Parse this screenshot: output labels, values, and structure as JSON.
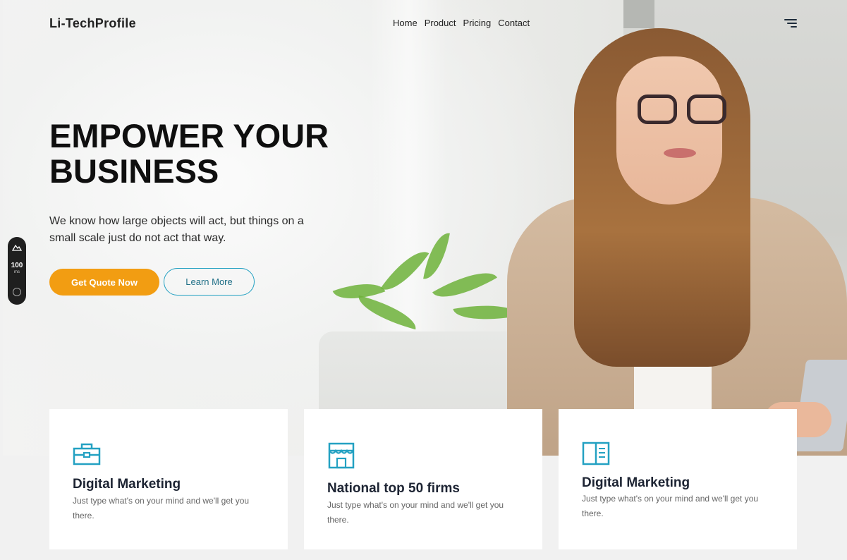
{
  "brand": "Li-TechProfile",
  "nav": [
    "Home",
    "Product",
    "Pricing",
    "Contact"
  ],
  "hero": {
    "headline_line1": "EMPOWER YOUR",
    "headline_line2": "BUSINESS",
    "lede": "We know how large objects will act, but things on a small scale just do not act that way.",
    "primary_cta": "Get Quote Now",
    "secondary_cta": "Learn More"
  },
  "side_widget": {
    "value": "100",
    "unit": "ms"
  },
  "cards": [
    {
      "icon": "briefcase-icon",
      "title": "Digital Marketing",
      "desc": "Just type what's on your mind and we'll get you there."
    },
    {
      "icon": "storefront-icon",
      "title": "National top 50 firms",
      "desc": "Just type what's on your mind and we'll get you there."
    },
    {
      "icon": "book-icon",
      "title": "Digital Marketing",
      "desc": "Just type what's on your mind and we'll get you there."
    }
  ],
  "colors": {
    "accent": "#f29d12",
    "teal": "#23a1c2",
    "title": "#1d2433"
  }
}
